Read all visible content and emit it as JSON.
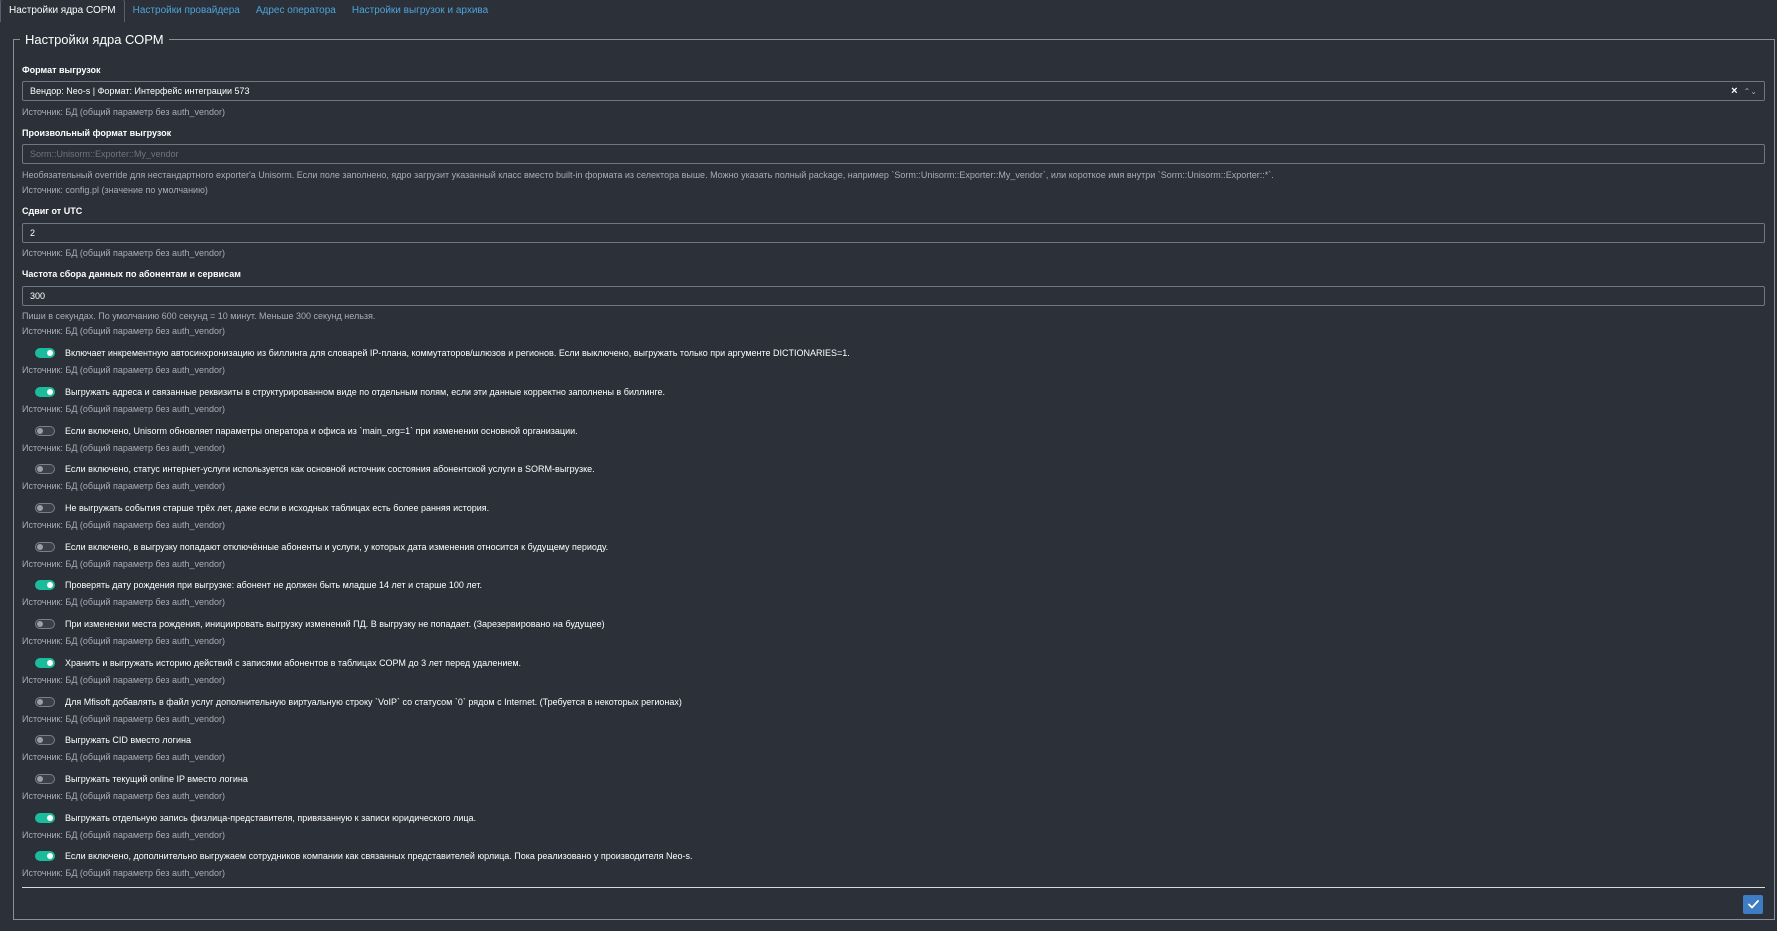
{
  "tabs": [
    {
      "label": "Настройки ядра СОРМ"
    },
    {
      "label": "Настройки провайдера"
    },
    {
      "label": "Адрес оператора"
    },
    {
      "label": "Настройки выгрузок и архива"
    }
  ],
  "panel": {
    "title": "Настройки ядра СОРМ"
  },
  "fields": {
    "format": {
      "label": "Формат выгрузок",
      "value": "Вендор: Neo-s | Формат: Интерфейс интеграции 573",
      "source": "Источник: БД (общий параметр без auth_vendor)"
    },
    "custom_format": {
      "label": "Произвольный формат выгрузок",
      "placeholder": "Sorm::Unisorm::Exporter::My_vendor",
      "hint": "Необязательный override для нестандартного exporter'а Unisorm. Если поле заполнено, ядро загрузит указанный класс вместо built-in формата из селектора выше. Можно указать полный package, например `Sorm::Unisorm::Exporter::My_vendor`, или короткое имя внутри `Sorm::Unisorm::Exporter::*`.",
      "source": "Источник: config.pl (значение по умолчанию)"
    },
    "utc_offset": {
      "label": "Сдвиг от UTC",
      "value": "2",
      "source": "Источник: БД (общий параметр без auth_vendor)"
    },
    "frequency": {
      "label": "Частота сбора данных по абонентам и сервисам",
      "value": "300",
      "hint": "Пиши в секундах. По умолчанию 600 секунд = 10 минут. Меньше 300 секунд нельзя.",
      "source": "Источник: БД (общий параметр без auth_vendor)"
    }
  },
  "toggles": [
    {
      "on": true,
      "text": "Включает инкрементную автосинхронизацию из биллинга для словарей IP-плана, коммутаторов/шлюзов и регионов. Если выключено, выгружать только при аргументе DICTIONARIES=1.",
      "source": "Источник: БД (общий параметр без auth_vendor)"
    },
    {
      "on": true,
      "text": "Выгружать адреса и связанные реквизиты в структурированном виде по отдельным полям, если эти данные корректно заполнены в биллинге.",
      "source": "Источник: БД (общий параметр без auth_vendor)"
    },
    {
      "on": false,
      "text": "Если включено, Unisorm обновляет параметры оператора и офиса из `main_org=1` при изменении основной организации.",
      "source": "Источник: БД (общий параметр без auth_vendor)"
    },
    {
      "on": false,
      "text": "Если включено, статус интернет-услуги используется как основной источник состояния абонентской услуги в SORM-выгрузке.",
      "source": "Источник: БД (общий параметр без auth_vendor)"
    },
    {
      "on": false,
      "text": "Не выгружать события старше трёх лет, даже если в исходных таблицах есть более ранняя история.",
      "source": "Источник: БД (общий параметр без auth_vendor)"
    },
    {
      "on": false,
      "text": "Если включено, в выгрузку попадают отключённые абоненты и услуги, у которых дата изменения относится к будущему периоду.",
      "source": "Источник: БД (общий параметр без auth_vendor)"
    },
    {
      "on": true,
      "text": "Проверять дату рождения при выгрузке: абонент не должен быть младше 14 лет и старше 100 лет.",
      "source": "Источник: БД (общий параметр без auth_vendor)"
    },
    {
      "on": false,
      "text": "При изменении места рождения, инициировать выгрузку изменений ПД. В выгрузку не попадает. (Зарезервировано на будущее)",
      "source": "Источник: БД (общий параметр без auth_vendor)"
    },
    {
      "on": true,
      "text": "Хранить и выгружать историю действий с записями абонентов в таблицах СОРМ до 3 лет перед удалением.",
      "source": "Источник: БД (общий параметр без auth_vendor)"
    },
    {
      "on": false,
      "text": "Для Mfisoft добавлять в файл услуг дополнительную виртуальную строку `VoIP` со статусом `0` рядом с Internet. (Требуется в некоторых регионах)",
      "source": "Источник: БД (общий параметр без auth_vendor)"
    },
    {
      "on": false,
      "text": "Выгружать CID вместо логина",
      "source": "Источник: БД (общий параметр без auth_vendor)"
    },
    {
      "on": false,
      "text": "Выгружать текущий online IP вместо логина",
      "source": "Источник: БД (общий параметр без auth_vendor)"
    },
    {
      "on": true,
      "text": "Выгружать отдельную запись физлица-представителя, привязанную к записи юридического лица.",
      "source": "Источник: БД (общий параметр без auth_vendor)"
    },
    {
      "on": true,
      "text": "Если включено, дополнительно выгружаем сотрудников компании как связанных представителей юрлица. Пока реализовано у производителя Neo-s.",
      "source": "Источник: БД (общий параметр без auth_vendor)"
    }
  ],
  "icons": {
    "clear": "×",
    "chevron": "⌃⌄",
    "save": "check-icon"
  },
  "colors": {
    "accent": "#1abc9c",
    "link": "#4fa3d9",
    "save": "#3e7cc4",
    "background": "#2b3039"
  }
}
